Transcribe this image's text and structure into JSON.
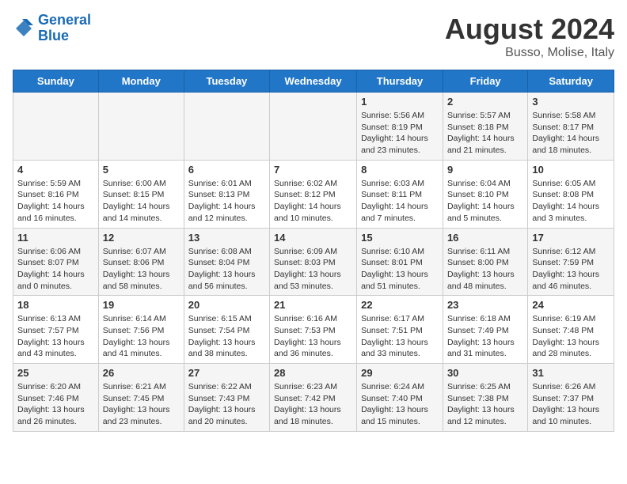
{
  "header": {
    "logo_line1": "General",
    "logo_line2": "Blue",
    "main_title": "August 2024",
    "subtitle": "Busso, Molise, Italy"
  },
  "days_of_week": [
    "Sunday",
    "Monday",
    "Tuesday",
    "Wednesday",
    "Thursday",
    "Friday",
    "Saturday"
  ],
  "weeks": [
    [
      {
        "day": "",
        "info": ""
      },
      {
        "day": "",
        "info": ""
      },
      {
        "day": "",
        "info": ""
      },
      {
        "day": "",
        "info": ""
      },
      {
        "day": "1",
        "info": "Sunrise: 5:56 AM\nSunset: 8:19 PM\nDaylight: 14 hours\nand 23 minutes."
      },
      {
        "day": "2",
        "info": "Sunrise: 5:57 AM\nSunset: 8:18 PM\nDaylight: 14 hours\nand 21 minutes."
      },
      {
        "day": "3",
        "info": "Sunrise: 5:58 AM\nSunset: 8:17 PM\nDaylight: 14 hours\nand 18 minutes."
      }
    ],
    [
      {
        "day": "4",
        "info": "Sunrise: 5:59 AM\nSunset: 8:16 PM\nDaylight: 14 hours\nand 16 minutes."
      },
      {
        "day": "5",
        "info": "Sunrise: 6:00 AM\nSunset: 8:15 PM\nDaylight: 14 hours\nand 14 minutes."
      },
      {
        "day": "6",
        "info": "Sunrise: 6:01 AM\nSunset: 8:13 PM\nDaylight: 14 hours\nand 12 minutes."
      },
      {
        "day": "7",
        "info": "Sunrise: 6:02 AM\nSunset: 8:12 PM\nDaylight: 14 hours\nand 10 minutes."
      },
      {
        "day": "8",
        "info": "Sunrise: 6:03 AM\nSunset: 8:11 PM\nDaylight: 14 hours\nand 7 minutes."
      },
      {
        "day": "9",
        "info": "Sunrise: 6:04 AM\nSunset: 8:10 PM\nDaylight: 14 hours\nand 5 minutes."
      },
      {
        "day": "10",
        "info": "Sunrise: 6:05 AM\nSunset: 8:08 PM\nDaylight: 14 hours\nand 3 minutes."
      }
    ],
    [
      {
        "day": "11",
        "info": "Sunrise: 6:06 AM\nSunset: 8:07 PM\nDaylight: 14 hours\nand 0 minutes."
      },
      {
        "day": "12",
        "info": "Sunrise: 6:07 AM\nSunset: 8:06 PM\nDaylight: 13 hours\nand 58 minutes."
      },
      {
        "day": "13",
        "info": "Sunrise: 6:08 AM\nSunset: 8:04 PM\nDaylight: 13 hours\nand 56 minutes."
      },
      {
        "day": "14",
        "info": "Sunrise: 6:09 AM\nSunset: 8:03 PM\nDaylight: 13 hours\nand 53 minutes."
      },
      {
        "day": "15",
        "info": "Sunrise: 6:10 AM\nSunset: 8:01 PM\nDaylight: 13 hours\nand 51 minutes."
      },
      {
        "day": "16",
        "info": "Sunrise: 6:11 AM\nSunset: 8:00 PM\nDaylight: 13 hours\nand 48 minutes."
      },
      {
        "day": "17",
        "info": "Sunrise: 6:12 AM\nSunset: 7:59 PM\nDaylight: 13 hours\nand 46 minutes."
      }
    ],
    [
      {
        "day": "18",
        "info": "Sunrise: 6:13 AM\nSunset: 7:57 PM\nDaylight: 13 hours\nand 43 minutes."
      },
      {
        "day": "19",
        "info": "Sunrise: 6:14 AM\nSunset: 7:56 PM\nDaylight: 13 hours\nand 41 minutes."
      },
      {
        "day": "20",
        "info": "Sunrise: 6:15 AM\nSunset: 7:54 PM\nDaylight: 13 hours\nand 38 minutes."
      },
      {
        "day": "21",
        "info": "Sunrise: 6:16 AM\nSunset: 7:53 PM\nDaylight: 13 hours\nand 36 minutes."
      },
      {
        "day": "22",
        "info": "Sunrise: 6:17 AM\nSunset: 7:51 PM\nDaylight: 13 hours\nand 33 minutes."
      },
      {
        "day": "23",
        "info": "Sunrise: 6:18 AM\nSunset: 7:49 PM\nDaylight: 13 hours\nand 31 minutes."
      },
      {
        "day": "24",
        "info": "Sunrise: 6:19 AM\nSunset: 7:48 PM\nDaylight: 13 hours\nand 28 minutes."
      }
    ],
    [
      {
        "day": "25",
        "info": "Sunrise: 6:20 AM\nSunset: 7:46 PM\nDaylight: 13 hours\nand 26 minutes."
      },
      {
        "day": "26",
        "info": "Sunrise: 6:21 AM\nSunset: 7:45 PM\nDaylight: 13 hours\nand 23 minutes."
      },
      {
        "day": "27",
        "info": "Sunrise: 6:22 AM\nSunset: 7:43 PM\nDaylight: 13 hours\nand 20 minutes."
      },
      {
        "day": "28",
        "info": "Sunrise: 6:23 AM\nSunset: 7:42 PM\nDaylight: 13 hours\nand 18 minutes."
      },
      {
        "day": "29",
        "info": "Sunrise: 6:24 AM\nSunset: 7:40 PM\nDaylight: 13 hours\nand 15 minutes."
      },
      {
        "day": "30",
        "info": "Sunrise: 6:25 AM\nSunset: 7:38 PM\nDaylight: 13 hours\nand 12 minutes."
      },
      {
        "day": "31",
        "info": "Sunrise: 6:26 AM\nSunset: 7:37 PM\nDaylight: 13 hours\nand 10 minutes."
      }
    ]
  ]
}
